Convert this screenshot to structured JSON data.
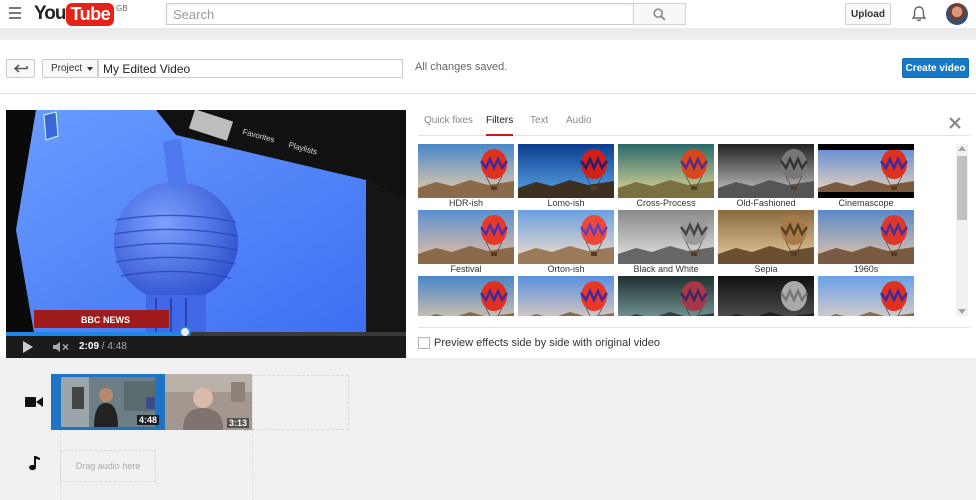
{
  "masthead": {
    "logo_you": "You",
    "logo_tube": "Tube",
    "logo_region": "GB",
    "search_placeholder": "Search",
    "upload_label": "Upload",
    "icons": [
      "menu-icon",
      "search-icon",
      "bell-icon",
      "avatar"
    ]
  },
  "toolbar": {
    "project_label": "Project",
    "project_name": "My Edited Video",
    "save_status": "All changes saved.",
    "create_label": "Create video",
    "accent_color": "#167ac6"
  },
  "player": {
    "current_time": "2:09",
    "total_time": "4:48",
    "progress": 0.448,
    "overlay_logo": "BBC NEWS",
    "overlay_menu": [
      "Favorites",
      "Playlists"
    ],
    "progress_color": "#1e87e6"
  },
  "effects": {
    "tabs": [
      {
        "label": "Quick fixes",
        "active": false
      },
      {
        "label": "Filters",
        "active": true
      },
      {
        "label": "Text",
        "active": false
      },
      {
        "label": "Audio",
        "active": false
      }
    ],
    "filters": [
      {
        "label": "HDR-ish"
      },
      {
        "label": "Lomo-ish"
      },
      {
        "label": "Cross-Process"
      },
      {
        "label": "Old-Fashioned"
      },
      {
        "label": "Cinemascope"
      },
      {
        "label": "Festival"
      },
      {
        "label": "Orton-ish"
      },
      {
        "label": "Black and White"
      },
      {
        "label": "Sepia"
      },
      {
        "label": "1960s"
      },
      {
        "label": ""
      },
      {
        "label": ""
      },
      {
        "label": ""
      },
      {
        "label": ""
      },
      {
        "label": ""
      }
    ],
    "preview_label": "Preview effects side by side with original video",
    "preview_checked": false
  },
  "timeline": {
    "clips": [
      {
        "duration": "4:48",
        "selected": true
      },
      {
        "duration": "3:13",
        "selected": false
      }
    ],
    "audio_placeholder": "Drag audio here"
  }
}
